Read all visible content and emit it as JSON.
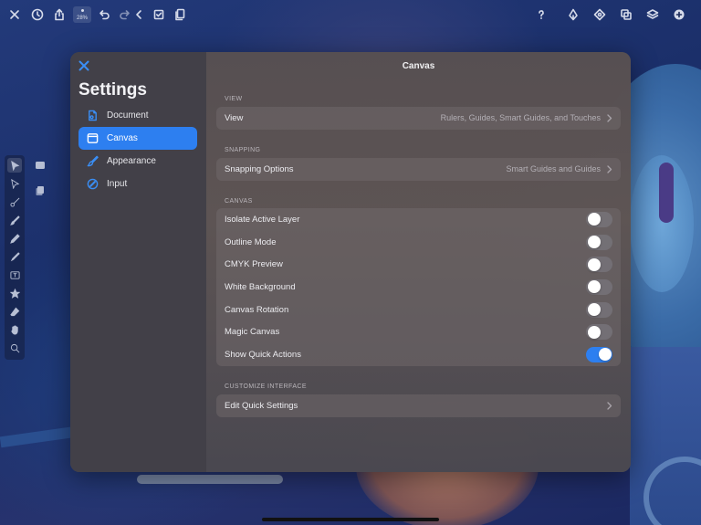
{
  "toolbar": {
    "zoom_label": "28%"
  },
  "settings": {
    "title": "Settings",
    "items": [
      {
        "label": "Document",
        "icon": "document-icon",
        "active": false
      },
      {
        "label": "Canvas",
        "icon": "canvas-icon",
        "active": true
      },
      {
        "label": "Appearance",
        "icon": "brush-icon",
        "active": false
      },
      {
        "label": "Input",
        "icon": "pencil-circle-icon",
        "active": false
      }
    ]
  },
  "canvas_panel": {
    "title": "Canvas",
    "sections": {
      "view": {
        "label": "VIEW",
        "row_label": "View",
        "row_value": "Rulers, Guides, Smart Guides, and Touches"
      },
      "snapping": {
        "label": "SNAPPING",
        "row_label": "Snapping Options",
        "row_value": "Smart Guides and Guides"
      },
      "canvas": {
        "label": "CANVAS",
        "toggles": [
          {
            "label": "Isolate Active Layer",
            "on": false
          },
          {
            "label": "Outline Mode",
            "on": false
          },
          {
            "label": "CMYK Preview",
            "on": false
          },
          {
            "label": "White Background",
            "on": false
          },
          {
            "label": "Canvas Rotation",
            "on": false
          },
          {
            "label": "Magic Canvas",
            "on": false
          },
          {
            "label": "Show Quick Actions",
            "on": true
          }
        ]
      },
      "customize": {
        "label": "CUSTOMIZE INTERFACE",
        "row_label": "Edit Quick Settings"
      }
    }
  },
  "colors": {
    "accent": "#2d7ff0",
    "icon_accent": "#3a8ef5"
  }
}
